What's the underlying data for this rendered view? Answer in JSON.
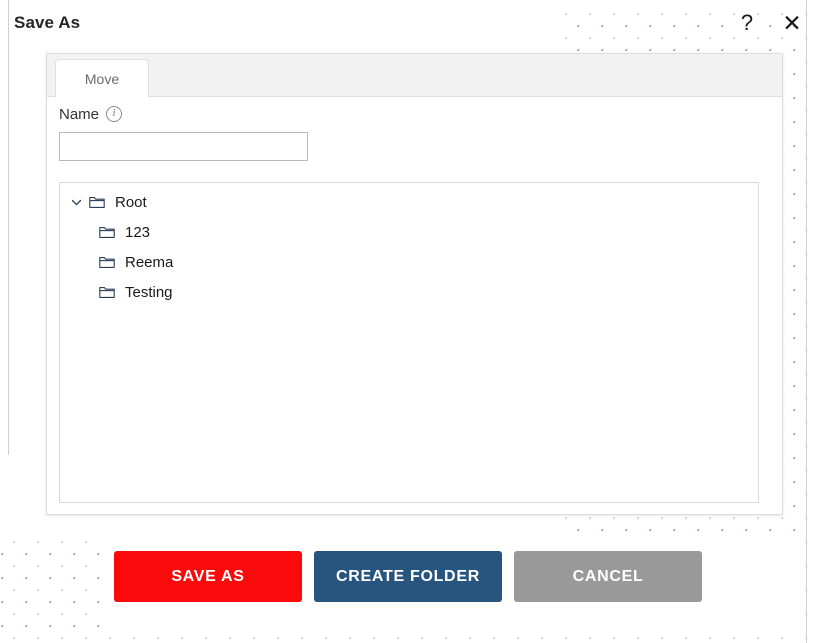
{
  "dialog": {
    "title": "Save As",
    "help_icon": "question-mark-icon",
    "close_icon": "close-x-icon",
    "help_glyph": "?",
    "close_glyph": "✕"
  },
  "tabs": [
    {
      "label": "Move",
      "active": true
    }
  ],
  "form": {
    "name_label": "Name",
    "info_icon": "info-circle-icon",
    "info_glyph": "i",
    "name_value": "",
    "name_placeholder": ""
  },
  "tree": {
    "root": {
      "label": "Root",
      "expanded": true,
      "chevron_icon": "chevron-down-icon",
      "folder_icon": "folder-icon"
    },
    "children": [
      {
        "label": "123",
        "folder_icon": "folder-icon"
      },
      {
        "label": "Reema",
        "folder_icon": "folder-icon"
      },
      {
        "label": "Testing",
        "folder_icon": "folder-icon"
      }
    ]
  },
  "actions": {
    "save": {
      "label": "SAVE AS",
      "color": "#fa0a0a"
    },
    "create_folder": {
      "label": "CREATE FOLDER",
      "color": "#275580"
    },
    "cancel": {
      "label": "CANCEL",
      "color": "#999999"
    }
  }
}
